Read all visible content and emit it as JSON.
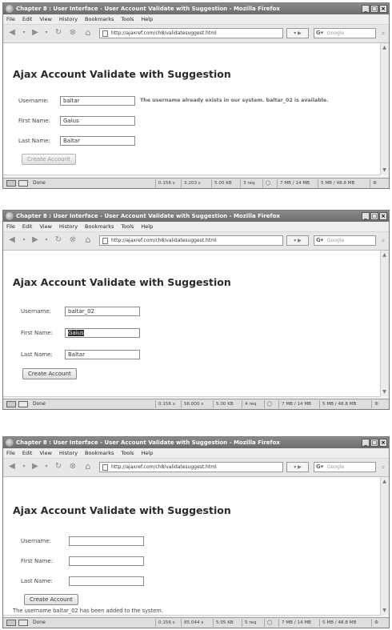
{
  "browser": {
    "title": "Chapter 8 : User Interface - User Account Validate with Suggestion - Mozilla Firefox",
    "menu": [
      "File",
      "Edit",
      "View",
      "History",
      "Bookmarks",
      "Tools",
      "Help"
    ],
    "url": "http://ajaxref.com/ch8/validatesuggest.html",
    "search_placeholder": "Google",
    "status_label": "Done"
  },
  "page": {
    "heading": "Ajax Account Validate with Suggestion",
    "labels": {
      "username": "Username:",
      "first_name": "First Name:",
      "last_name": "Last Name:"
    },
    "button_label": "Create Account"
  },
  "screens": [
    {
      "username": "baltar",
      "first_name": "Gaius",
      "last_name": "Baltar",
      "suggestion": "The username already exists in our system. baltar_02 is available.",
      "status_cells": [
        "0.156 s",
        "3.203 s",
        "5.00 KB",
        "3 req",
        "7 MB / 14 MB",
        "5 MB / 48.8 MB"
      ]
    },
    {
      "username": "baltar_02",
      "first_name": "Gaius",
      "last_name": "Baltar",
      "status_cells": [
        "0.156 s",
        "56.000 s",
        "5.00 KB",
        "4 req",
        "7 MB / 14 MB",
        "5 MB / 48.8 MB"
      ]
    },
    {
      "username": "",
      "first_name": "",
      "last_name": "",
      "message": "The username baltar_02 has been added to the system.",
      "status_cells": [
        "0.156 s",
        "85.044 s",
        "5.05 KB",
        "5 req",
        "7 MB / 14 MB",
        "5 MB / 48.8 MB"
      ]
    }
  ]
}
